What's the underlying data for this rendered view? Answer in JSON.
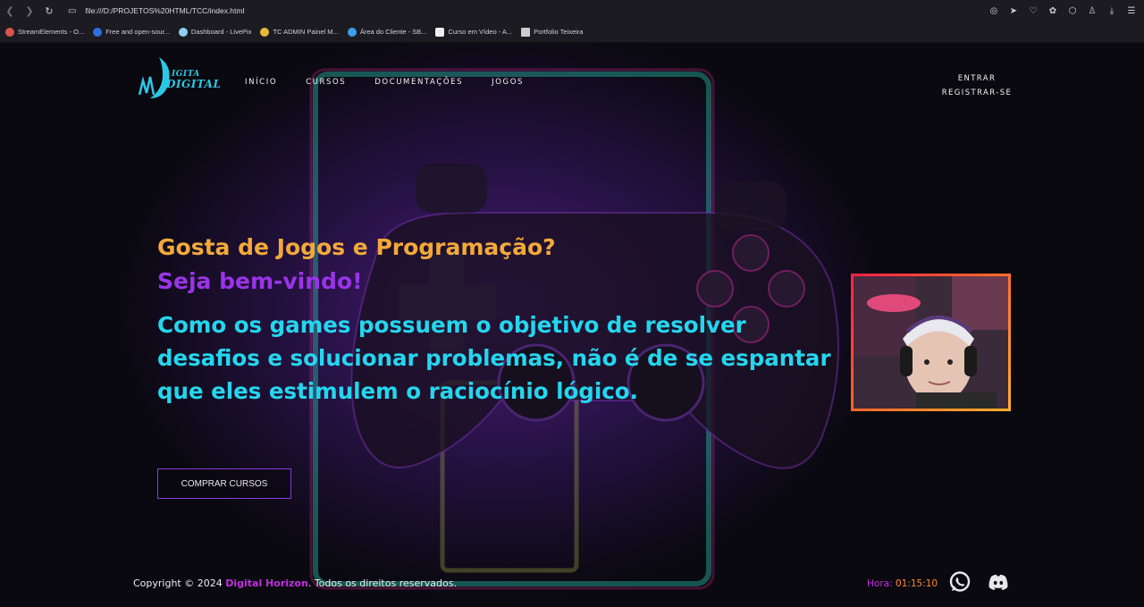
{
  "browser": {
    "url": "file:///D:/PROJETOS%20HTML/TCC/index.html",
    "bookmarks": [
      {
        "label": "StreamElements - O...",
        "color": "#d9534f"
      },
      {
        "label": "Free and open-sour...",
        "color": "#2f6fde"
      },
      {
        "label": "Dashboard - LivePix",
        "color": "#8fd0f0"
      },
      {
        "label": "TC ADMIN Painel M...",
        "color": "#e8b73a"
      },
      {
        "label": "Área do Cliente - SB...",
        "color": "#3aa0e8"
      },
      {
        "label": "Curso em Vídeo - A...",
        "color": "#eeeeee"
      },
      {
        "label": "Portfolio Teixeira",
        "color": "#cccccc"
      }
    ]
  },
  "header": {
    "logo_text_top": "IGITA",
    "logo_text_bottom": "DIGITAL",
    "menu": [
      "INÍCIO",
      "CURSOS",
      "DOCUMENTAÇÕES",
      "JOGOS"
    ],
    "login_label": "ENTRAR",
    "register_label": "REGISTRAR-SE"
  },
  "hero": {
    "question": "Gosta de Jogos e Programação?",
    "welcome": "Seja bem-vindo!",
    "paragraph": "Como os games possuem o objetivo de resolver desafios e solucionar problemas, não é de se espantar que eles estimulem o raciocínio lógico.",
    "button_label": "COMPRAR CURSOS"
  },
  "footer": {
    "copyright_prefix": "Copyright © 2024 ",
    "brand": "Digital Horizon",
    "copyright_suffix": ". Todos os direitos reservados.",
    "clock_label": "Hora: ",
    "clock_value": "01:15:10"
  },
  "colors": {
    "question": "#f3a93a",
    "welcome": "#9a34e8",
    "paragraph": "#24d6ee",
    "brand": "#c22ee0",
    "frame_start": "#ff1f4a",
    "frame_end": "#ffb02a"
  },
  "icons": [
    "back-icon",
    "forward-icon",
    "reload-icon",
    "whatsapp-icon",
    "discord-icon"
  ]
}
